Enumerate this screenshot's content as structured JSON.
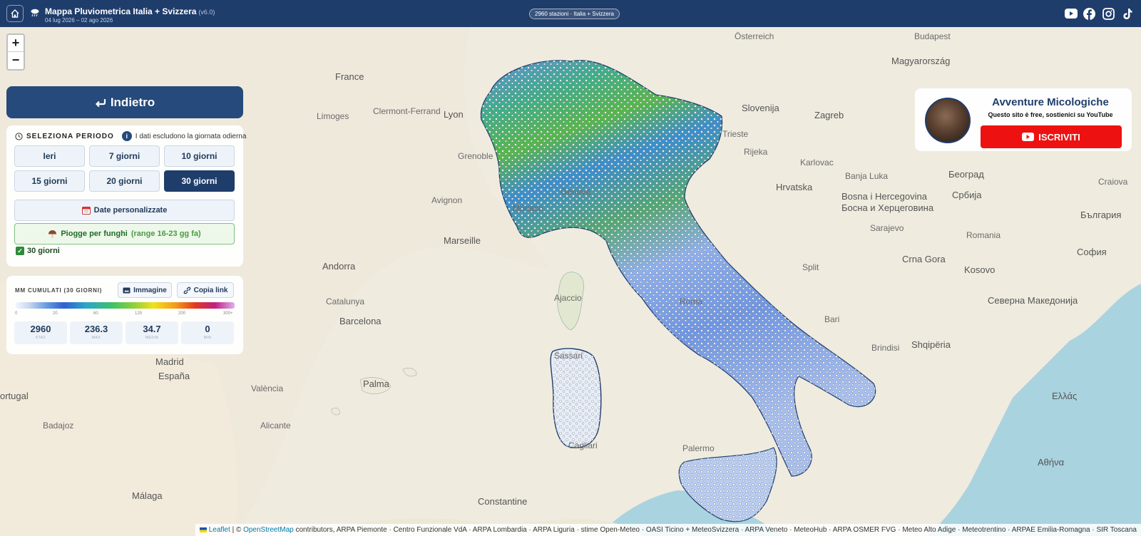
{
  "header": {
    "title": "Mappa Pluviometrica Italia + Svizzera",
    "version": "(v6.0)",
    "dates": "04 lug 2026 – 02 ago 2026",
    "stations_badge": "2960 stazioni · Italia + Svizzera",
    "social_icons": [
      "youtube-icon",
      "facebook-icon",
      "instagram-icon",
      "tiktok-icon"
    ]
  },
  "map": {
    "zoom_in": "+",
    "zoom_out": "−",
    "labels": {
      "osterreich": "Österreich",
      "budapest": "Budapest",
      "magyarorszag": "Magyarország",
      "slovenija": "Slovenija",
      "zagreb": "Zagreb",
      "hrvatska": "Hrvatska",
      "bih": "Bosna i Hercegovina",
      "bih2": "Босна и Херцеговина",
      "srbija": "Србија",
      "beograd": "Београд",
      "sarajevo": "Sarajevo",
      "crna_gora": "Crna Gora",
      "kosovo": "Kosovo",
      "romania": "Romania",
      "craiova": "Craiova",
      "bulgaria": "България",
      "sofia": "София",
      "makedonija": "Северна Македонија",
      "shqiperia": "Shqipëria",
      "ellada": "Ελλάς",
      "athina": "Αθήνα",
      "france": "France",
      "clermont": "Clermont-Ferrand",
      "limoges": "Limoges",
      "lyon": "Lyon",
      "grenoble": "Grenoble",
      "avignon": "Avignon",
      "marseille": "Marseille",
      "genova": "Genova",
      "monaco": "Monaco",
      "trieste": "Trieste",
      "rijeka": "Rijeka",
      "karlovac": "Karlovac",
      "banja_luka": "Banja Luka",
      "split": "Split",
      "andorra": "Andorra",
      "catalunya": "Catalunya",
      "barcelona": "Barcelona",
      "madrid": "Madrid",
      "espana": "España",
      "valencia": "València",
      "palma": "Palma",
      "ajaccio": "Ajaccio",
      "sassari": "Sassari",
      "cagliari": "Cagliari",
      "roma": "Roma",
      "bari": "Bari",
      "brindisi": "Brindisi",
      "palermo": "Palermo",
      "constantine": "Constantine",
      "malaga": "Málaga",
      "portugal": "ortugal",
      "badajoz": "Badajoz",
      "alicante": "Alicante"
    }
  },
  "back_button": {
    "label": "Indietro"
  },
  "period": {
    "title": "SELEZIONA PERIODO",
    "note": "I dati escludono la giornata odierna",
    "buttons": [
      "Ieri",
      "7 giorni",
      "10 giorni",
      "15 giorni",
      "20 giorni",
      "30 giorni"
    ],
    "active": "30 giorni",
    "custom_label": "Date personalizzate",
    "mushroom_label": "Piogge per funghi",
    "mushroom_range": "(range 16-23 gg fa)",
    "checked_label": "30 giorni"
  },
  "stats": {
    "title": "MM CUMULATI (30 GIORNI)",
    "image_btn": "Immagine",
    "copy_btn": "Copia link",
    "ticks": [
      "0",
      "20",
      "60",
      "125",
      "200",
      "300+"
    ],
    "items": [
      {
        "value": "2960",
        "label": "STAZ"
      },
      {
        "value": "236.3",
        "label": "MAX"
      },
      {
        "value": "34.7",
        "label": "MEDIA"
      },
      {
        "value": "0",
        "label": "MIN"
      }
    ]
  },
  "promo": {
    "title": "Avventure Micologiche",
    "subtitle": "Questo sito è free, sostienici su YouTube",
    "button": "ISCRIVITI"
  },
  "attribution": {
    "leaflet": "Leaflet",
    "sep": "| ©",
    "osm": "OpenStreetMap",
    "rest": "contributors, ARPA Piemonte · Centro Funzionale VdA · ARPA Lombardia · ARPA Liguria · stime Open-Meteo · OASI Ticino + MeteoSvizzera · ARPA Veneto · MeteoHub · ARPA OSMER FVG · Meteo Alto Adige · Meteotrentino · ARPAE Emilia-Romagna · SIR Toscana"
  },
  "colors": {
    "header_bg": "#1f3d6b",
    "accent": "#254a7b",
    "subscribe": "#ee1111",
    "mushroom_green": "#1e6b2a"
  }
}
